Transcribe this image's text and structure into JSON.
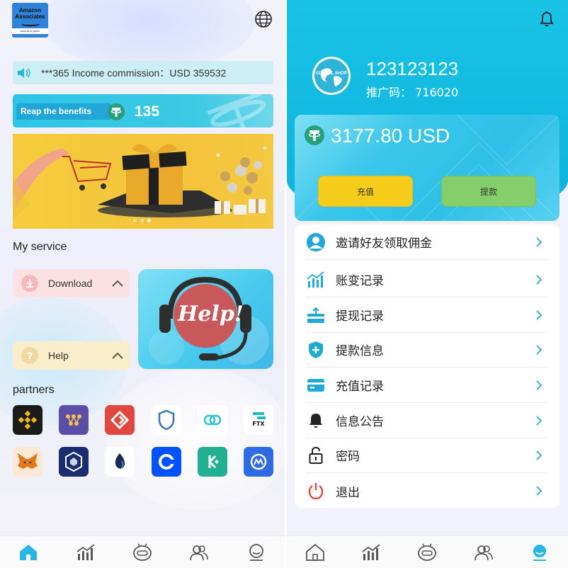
{
  "left": {
    "logo": {
      "line1": "Amazon",
      "line2": "Associates",
      "url": "www.amz.place"
    },
    "notice": {
      "text": "***365 Income commission：USD 359532"
    },
    "benefit": {
      "label": "Reap the benefits",
      "value": "135"
    },
    "banner": {
      "slides": 3,
      "active_slide": 3
    },
    "my_service": {
      "title": "My service",
      "download_label": "Download",
      "help_label": "Help",
      "help_card_text": "Help!"
    },
    "partners": {
      "title": "partners",
      "icons": [
        "binance-icon",
        "tiers-icon",
        "gatechain-icon",
        "trust-wallet-icon",
        "link-icon",
        "ftx-icon",
        "metamask-icon",
        "crypto-com-icon",
        "huobi-icon",
        "coinbase-icon",
        "kucoin-icon",
        "coinmarketcap-icon"
      ],
      "ftx_text": "FTX"
    },
    "tabbar": [
      "home-icon",
      "market-icon",
      "robot-icon",
      "team-icon",
      "profile-icon"
    ],
    "active_tab": "home-icon"
  },
  "right": {
    "shop_logo_text": "GLOBAL SHOP",
    "username": "123123123",
    "ref_label": "推广码：",
    "ref_code": "716020",
    "balance": "3177.80 USD",
    "recharge_label": "充值",
    "withdraw_label": "提款",
    "menu": [
      {
        "icon": "user-icon",
        "label": "邀请好友领取佣金"
      },
      {
        "icon": "chart-icon",
        "label": "账变记录"
      },
      {
        "icon": "upload-icon",
        "label": "提现记录"
      },
      {
        "icon": "shield-plus-icon",
        "label": "提款信息"
      },
      {
        "icon": "card-icon",
        "label": "充值记录"
      },
      {
        "icon": "bell-icon",
        "label": "信息公告"
      },
      {
        "icon": "lock-icon",
        "label": "密码"
      },
      {
        "icon": "power-icon",
        "label": "退出"
      }
    ],
    "tabbar": [
      "home-icon",
      "market-icon",
      "robot-icon",
      "team-icon",
      "profile-icon"
    ],
    "active_tab": "profile-icon"
  },
  "colors": {
    "accent": "#12b8e0",
    "recharge": "#f6cd1b",
    "withdraw": "#84cf6b",
    "tether": "#26a17b"
  }
}
